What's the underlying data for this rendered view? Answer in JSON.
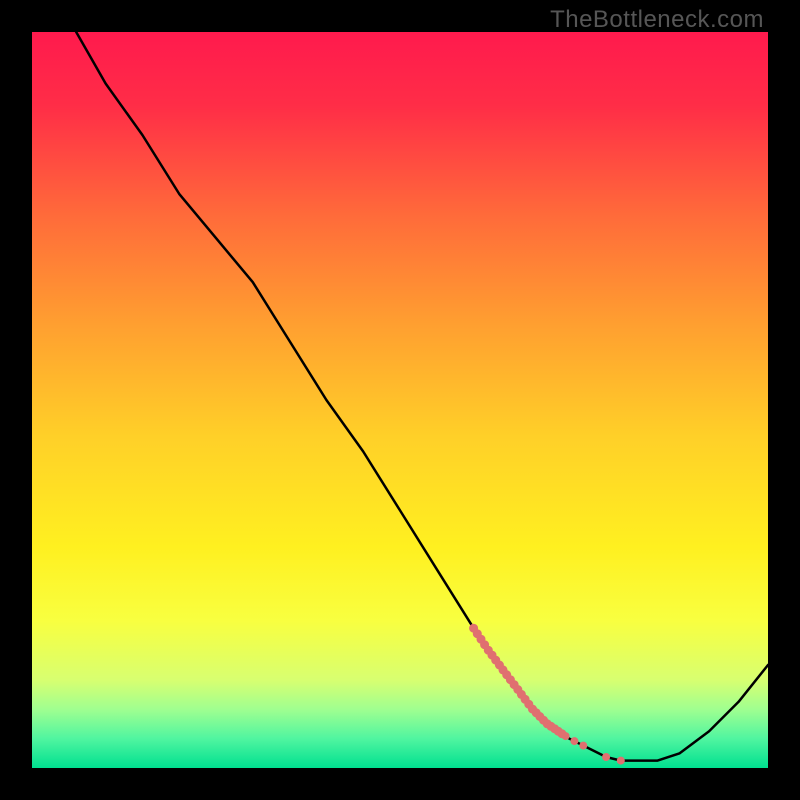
{
  "watermark": "TheBottleneck.com",
  "chart_data": {
    "type": "line",
    "title": "",
    "xlabel": "",
    "ylabel": "",
    "xlim": [
      0,
      100
    ],
    "ylim": [
      0,
      100
    ],
    "grid": false,
    "legend": false,
    "description": "Bottleneck percentage curve over a red-yellow-green vertical gradient background. Curve descends from top-left, reaches minimum (green zone) around x≈78–85, then rises.",
    "series": [
      {
        "name": "bottleneck-curve",
        "color": "#000000",
        "x": [
          6,
          10,
          15,
          20,
          25,
          30,
          35,
          40,
          45,
          50,
          55,
          60,
          62,
          65,
          68,
          70,
          73,
          76,
          78,
          80,
          82,
          85,
          88,
          92,
          96,
          100
        ],
        "y": [
          100,
          93,
          86,
          78,
          72,
          66,
          58,
          50,
          43,
          35,
          27,
          19,
          16,
          12,
          8,
          6,
          4,
          2.5,
          1.5,
          1,
          1,
          1,
          2,
          5,
          9,
          14
        ]
      }
    ],
    "highlight_segment": {
      "name": "salmon-dots",
      "color": "#e07070",
      "x_start": 60,
      "x_end": 80,
      "comment": "Thicker salmon-colored dotted overlay on curve between roughly x=60 and x=80"
    },
    "gradient_stops": [
      {
        "offset": 0.0,
        "color": "#ff1a4d"
      },
      {
        "offset": 0.1,
        "color": "#ff2d47"
      },
      {
        "offset": 0.25,
        "color": "#ff6b3a"
      },
      {
        "offset": 0.4,
        "color": "#ffa030"
      },
      {
        "offset": 0.55,
        "color": "#ffd028"
      },
      {
        "offset": 0.7,
        "color": "#fff020"
      },
      {
        "offset": 0.8,
        "color": "#f8ff40"
      },
      {
        "offset": 0.88,
        "color": "#d8ff70"
      },
      {
        "offset": 0.92,
        "color": "#a0ff90"
      },
      {
        "offset": 0.96,
        "color": "#50f5a0"
      },
      {
        "offset": 1.0,
        "color": "#00e090"
      }
    ]
  }
}
